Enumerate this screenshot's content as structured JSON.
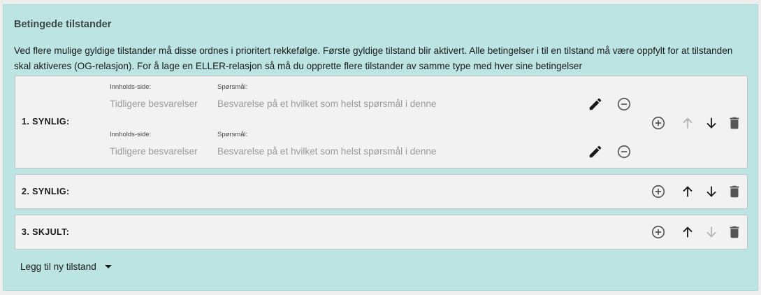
{
  "section": {
    "title": "Betingede tilstander",
    "description": "Ved flere mulige gyldige tilstander må disse ordnes i prioritert rekkefølge. Første gyldige tilstand blir aktivert. Alle betingelser i til en tilstand må være oppfylt for at tilstanden skal aktiveres (OG-relasjon). For å lage en ELLER-relasjon så må du opprette flere tilstander av samme type med hver sine betingelser"
  },
  "states": [
    {
      "label": "1.  SYNLIG:",
      "conditions": [
        {
          "side_label": "Innholds-side:",
          "side_value": "Tidligere besvarelser",
          "question_label": "Spørsmål:",
          "question_value": "Besvarelse på et hvilket som helst spørsmål i denne"
        },
        {
          "side_label": "Innholds-side:",
          "side_value": "Tidligere besvarelser",
          "question_label": "Spørsmål:",
          "question_value": "Besvarelse på et hvilket som helst spørsmål i denne"
        }
      ],
      "move_up_enabled": false,
      "move_down_enabled": true
    },
    {
      "label": "2.  SYNLIG:",
      "conditions": [],
      "move_up_enabled": true,
      "move_down_enabled": true
    },
    {
      "label": "3.  SKJULT:",
      "conditions": [],
      "move_up_enabled": true,
      "move_down_enabled": false
    }
  ],
  "add_state_label": "Legg til ny tilstand",
  "colors": {
    "panel_bg": "#bce4e3",
    "row_bg": "#f2f2f2",
    "icon_dark": "#1a1a1a",
    "icon_gray": "#555555",
    "icon_disabled": "#b5b5b5"
  }
}
